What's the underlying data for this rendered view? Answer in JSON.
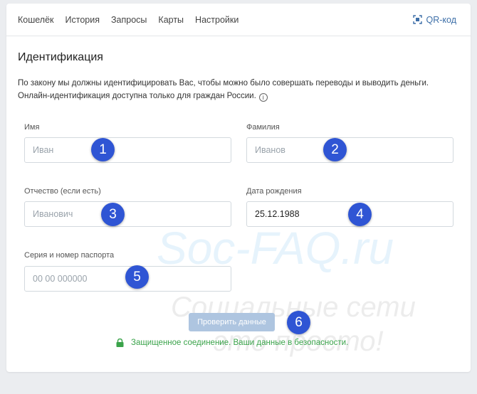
{
  "nav": {
    "items": [
      "Кошелёк",
      "История",
      "Запросы",
      "Карты",
      "Настройки"
    ],
    "qr_label": "QR-код"
  },
  "page": {
    "title": "Идентификация",
    "description_line1": "По закону мы должны идентифицировать Вас, чтобы можно было совершать переводы и выводить деньги.",
    "description_line2": "Онлайн-идентификация доступна только для граждан России.",
    "info_icon": "i"
  },
  "form": {
    "first_name": {
      "label": "Имя",
      "placeholder": "Иван",
      "value": ""
    },
    "last_name": {
      "label": "Фамилия",
      "placeholder": "Иванов",
      "value": ""
    },
    "patronymic": {
      "label": "Отчество (если есть)",
      "placeholder": "Иванович",
      "value": ""
    },
    "birth_date": {
      "label": "Дата рождения",
      "placeholder": "",
      "value": "25.12.1988"
    },
    "passport": {
      "label": "Серия и номер паспорта",
      "placeholder": "00 00 000000",
      "value": ""
    },
    "submit_label": "Проверить данные"
  },
  "secure_note": "Защищенное соединение. Ваши данные в безопасности.",
  "badges": [
    "1",
    "2",
    "3",
    "4",
    "5",
    "6"
  ],
  "watermark": {
    "line1": "Soc-FAQ.ru",
    "line2": "Социальные сети",
    "line3": "это просто!"
  },
  "colors": {
    "accent": "#3d6fa8",
    "badge": "#2f55d4",
    "secure": "#3aa34a",
    "button_disabled": "#aec5e0"
  }
}
